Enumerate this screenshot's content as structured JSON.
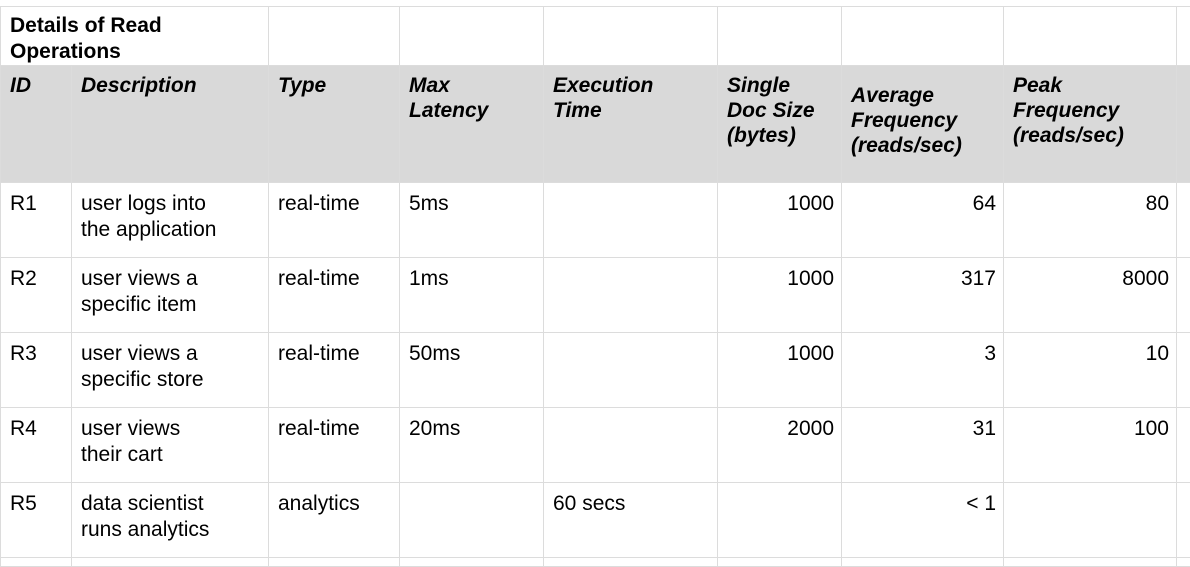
{
  "title": "Details of Read Operations",
  "headers": {
    "id": "ID",
    "description": "Description",
    "type": "Type",
    "max_latency": [
      "Max",
      "Latency"
    ],
    "execution_time": [
      "Execution",
      "Time"
    ],
    "single_doc_size": [
      "Single",
      "Doc Size",
      "(bytes)"
    ],
    "average_frequency": [
      "Average",
      "Frequency",
      "(reads/sec)"
    ],
    "peak_frequency": [
      "Peak",
      "Frequency",
      "(reads/sec)"
    ]
  },
  "rows": [
    {
      "id": "R1",
      "description": [
        "user logs into",
        "the application"
      ],
      "type": "real-time",
      "max_latency": "5ms",
      "execution_time": "",
      "single_doc_size": "1000",
      "average_frequency": "64",
      "peak_frequency": "80"
    },
    {
      "id": "R2",
      "description": [
        "user views a",
        "specific item"
      ],
      "type": "real-time",
      "max_latency": "1ms",
      "execution_time": "",
      "single_doc_size": "1000",
      "average_frequency": "317",
      "peak_frequency": "8000"
    },
    {
      "id": "R3",
      "description": [
        "user views a",
        "specific store"
      ],
      "type": "real-time",
      "max_latency": "50ms",
      "execution_time": "",
      "single_doc_size": "1000",
      "average_frequency": "3",
      "peak_frequency": "10"
    },
    {
      "id": "R4",
      "description": [
        "user views",
        "their cart"
      ],
      "type": "real-time",
      "max_latency": "20ms",
      "execution_time": "",
      "single_doc_size": "2000",
      "average_frequency": "31",
      "peak_frequency": "100"
    },
    {
      "id": "R5",
      "description": [
        "data scientist",
        "runs analytics"
      ],
      "type": "analytics",
      "max_latency": "",
      "execution_time": "60 secs",
      "single_doc_size": "",
      "average_frequency": "< 1",
      "peak_frequency": ""
    }
  ]
}
